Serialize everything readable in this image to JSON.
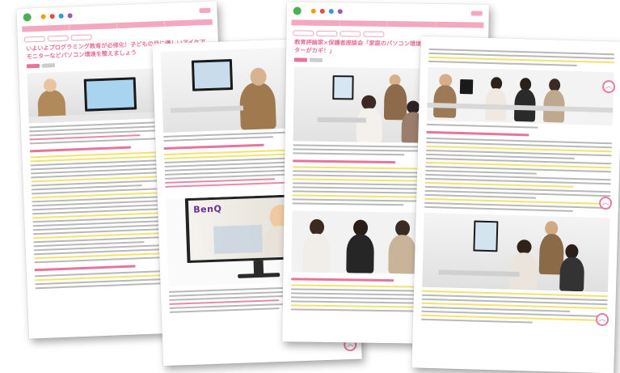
{
  "colors": {
    "brand_pink": "#e8749a",
    "nav_pink": "#f4a8bf",
    "highlight_yellow": "#f2e36a",
    "logo_green": "#4caf50"
  },
  "pages": [
    {
      "title": "いよいよプログラミング教育が必修化！子どもの目に優しいアイケアモニターなどパソコン環境を整えましょう"
    },
    {
      "monitor_brand": "BenQ"
    },
    {
      "title": "教育評論家×保護者座談会「家庭のパソコン環境の悩み、アイケアモニターがカギ！」"
    },
    {}
  ],
  "icons": {
    "scroll_top": "chevron-up-icon",
    "logo": "site-logo-icon"
  },
  "scroll_top_glyph": "︿"
}
